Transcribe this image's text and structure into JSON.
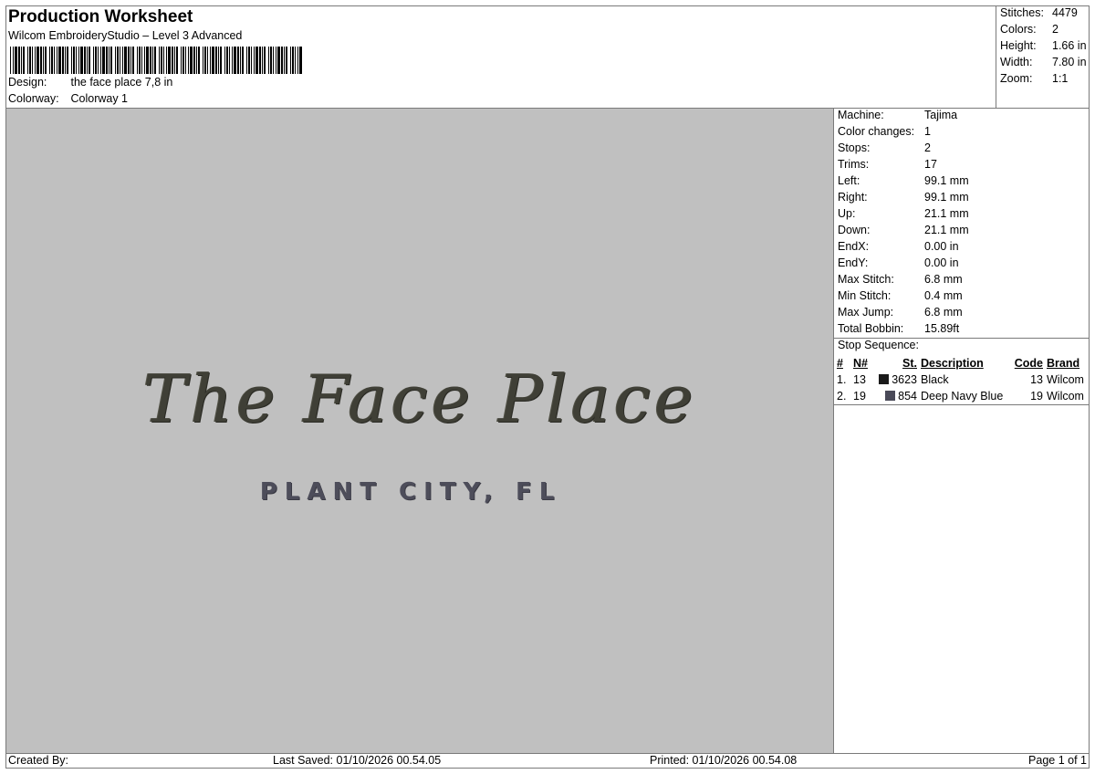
{
  "header": {
    "title": "Production Worksheet",
    "software": "Wilcom EmbroideryStudio – Level 3 Advanced",
    "design_label": "Design:",
    "design_value": "the face place 7,8 in",
    "colorway_label": "Colorway:",
    "colorway_value": "Colorway 1"
  },
  "summary": [
    {
      "label": "Stitches:",
      "value": "4479"
    },
    {
      "label": "Colors:",
      "value": "2"
    },
    {
      "label": "Height:",
      "value": "1.66 in"
    },
    {
      "label": "Width:",
      "value": "7.80 in"
    },
    {
      "label": "Zoom:",
      "value": "1:1"
    }
  ],
  "design_preview": {
    "script_text": "The Face Place",
    "city_text": "PLANT CITY, FL",
    "background_color": "#c0c0c0"
  },
  "machine_info": [
    {
      "label": "Machine:",
      "value": "Tajima"
    },
    {
      "label": "Color changes:",
      "value": "1"
    },
    {
      "label": "Stops:",
      "value": "2"
    },
    {
      "label": "Trims:",
      "value": "17"
    },
    {
      "label": "Left:",
      "value": "99.1 mm"
    },
    {
      "label": "Right:",
      "value": "99.1 mm"
    },
    {
      "label": "Up:",
      "value": "21.1 mm"
    },
    {
      "label": "Down:",
      "value": "21.1 mm"
    },
    {
      "label": "EndX:",
      "value": "0.00 in"
    },
    {
      "label": "EndY:",
      "value": "0.00 in"
    },
    {
      "label": "Max Stitch:",
      "value": "6.8 mm"
    },
    {
      "label": "Min Stitch:",
      "value": "0.4 mm"
    },
    {
      "label": "Max Jump:",
      "value": "6.8 mm"
    },
    {
      "label": "Total Bobbin:",
      "value": "15.89ft"
    }
  ],
  "stop_sequence": {
    "title": "Stop Sequence:",
    "columns": [
      "#",
      "N#",
      "St.",
      "Description",
      "Code",
      "Brand"
    ],
    "rows": [
      {
        "index": "1.",
        "n": "13",
        "color": "#1a1a1a",
        "stitches": "3623",
        "description": "Black",
        "code": "13",
        "brand": "Wilcom"
      },
      {
        "index": "2.",
        "n": "19",
        "color": "#4a4a58",
        "stitches": "854",
        "description": "Deep Navy Blue",
        "code": "19",
        "brand": "Wilcom"
      }
    ]
  },
  "footer": {
    "created_by": "Created By:",
    "last_saved": "Last Saved: 01/10/2026 00.54.05",
    "printed": "Printed: 01/10/2026 00.54.08",
    "page": "Page 1 of 1"
  }
}
